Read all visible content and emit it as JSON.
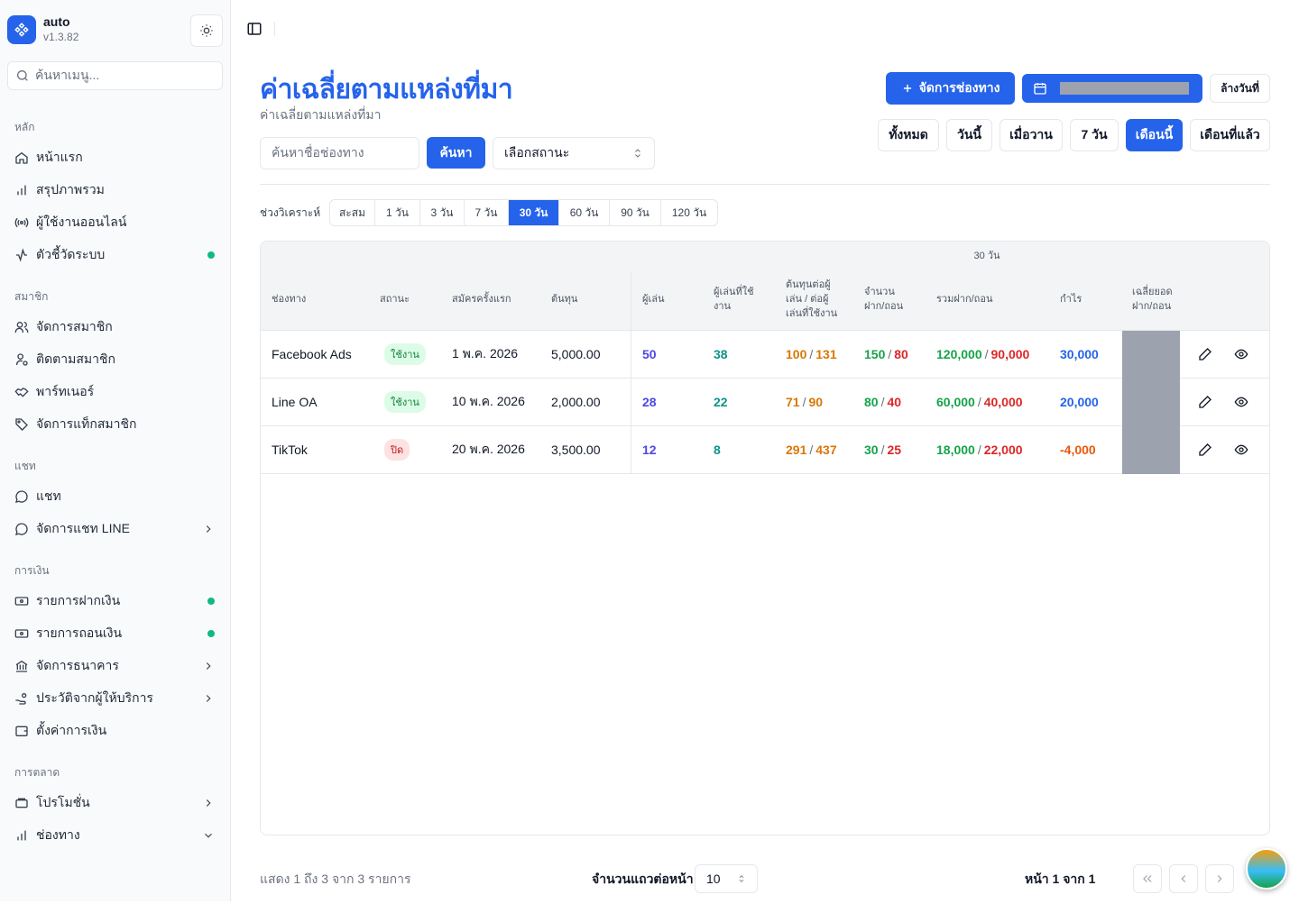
{
  "brand": {
    "name": "auto",
    "version": "v1.3.82"
  },
  "sidebar_search": {
    "placeholder": "ค้นหาเมนู..."
  },
  "nav_groups": {
    "main": "หลัก",
    "members": "สมาชิก",
    "chat": "แชท",
    "finance": "การเงิน",
    "marketing": "การตลาด"
  },
  "nav": {
    "home": "หน้าแรก",
    "overview": "สรุปภาพรวม",
    "online_users": "ผู้ใช้งานออนไลน์",
    "system_metrics": "ตัวชี้วัดระบบ",
    "manage_members": "จัดการสมาชิก",
    "track_members": "ติดตามสมาชิก",
    "partners": "พาร์ทเนอร์",
    "member_tags": "จัดการแท็กสมาชิก",
    "chat": "แชท",
    "line_chat": "จัดการแชท LINE",
    "deposits": "รายการฝากเงิน",
    "withdrawals": "รายการถอนเงิน",
    "banks": "จัดการธนาคาร",
    "provider_history": "ประวัติจากผู้ให้บริการ",
    "finance_settings": "ตั้งค่าการเงิน",
    "promotions": "โปรโมชั่น",
    "channels": "ช่องทาง"
  },
  "page": {
    "title": "ค่าเฉลี่ยตามแหล่งที่มา",
    "subtitle": "ค่าเฉลี่ยตามแหล่งที่มา"
  },
  "actions": {
    "manage_channels": "จัดการช่องทาง",
    "clear_date": "ล้างวันที่"
  },
  "quick_dates": [
    "ทั้งหมด",
    "วันนี้",
    "เมื่อวาน",
    "7 วัน",
    "เดือนนี้",
    "เดือนที่แล้ว"
  ],
  "quick_dates_active": "เดือนนี้",
  "filters": {
    "search_placeholder": "ค้นหาชื่อช่องทาง",
    "search_button": "ค้นหา",
    "status_select": "เลือกสถานะ"
  },
  "range": {
    "label": "ช่วงวิเคราะห์",
    "options": [
      "สะสม",
      "1 วัน",
      "3 วัน",
      "7 วัน",
      "30 วัน",
      "60 วัน",
      "90 วัน",
      "120 วัน"
    ],
    "active": "30 วัน"
  },
  "table": {
    "group_header": "30 วัน",
    "headers": {
      "channel": "ช่องทาง",
      "status": "สถานะ",
      "first_signup": "สมัครครั้งแรก",
      "cost": "ต้นทุน",
      "players": "ผู้เล่น",
      "active_players_1": "ผู้เล่นที่ใช้",
      "active_players_2": "งาน",
      "cost_per_1": "ต้นทุนต่อผู้",
      "cost_per_2": "เล่น / ต่อผู้",
      "cost_per_3": "เล่นที่ใช้งาน",
      "count_1": "จำนวน",
      "count_2": "ฝาก/ถอน",
      "total": "รวมฝาก/ถอน",
      "profit": "กำไร",
      "avg_1": "เฉลี่ยยอด",
      "avg_2": "ฝาก/ถอน"
    },
    "rows": [
      {
        "channel": "Facebook Ads",
        "status": "ใช้งาน",
        "status_on": true,
        "first_signup": "1 พ.ค. 2026",
        "cost": "5,000.00",
        "players": "50",
        "active_players": "38",
        "cpp": "100",
        "cpap": "131",
        "dep_count": "150",
        "wd_count": "80",
        "dep_total": "120,000",
        "wd_total": "90,000",
        "profit": "30,000",
        "profit_negative": false
      },
      {
        "channel": "Line OA",
        "status": "ใช้งาน",
        "status_on": true,
        "first_signup": "10 พ.ค. 2026",
        "cost": "2,000.00",
        "players": "28",
        "active_players": "22",
        "cpp": "71",
        "cpap": "90",
        "dep_count": "80",
        "wd_count": "40",
        "dep_total": "60,000",
        "wd_total": "40,000",
        "profit": "20,000",
        "profit_negative": false
      },
      {
        "channel": "TikTok",
        "status": "ปิด",
        "status_on": false,
        "first_signup": "20 พ.ค. 2026",
        "cost": "3,500.00",
        "players": "12",
        "active_players": "8",
        "cpp": "291",
        "cpap": "437",
        "dep_count": "30",
        "wd_count": "25",
        "dep_total": "18,000",
        "wd_total": "22,000",
        "profit": "-4,000",
        "profit_negative": true
      }
    ]
  },
  "footer": {
    "showing": "แสดง 1 ถึง 3 จาก 3 รายการ",
    "rows_per_page_label": "จำนวนแถวต่อหน้า",
    "rows_per_page": "10",
    "page_info": "หน้า 1 จาก 1"
  },
  "colors": {
    "accent": "#2563eb",
    "online_dot": "#10b981"
  }
}
